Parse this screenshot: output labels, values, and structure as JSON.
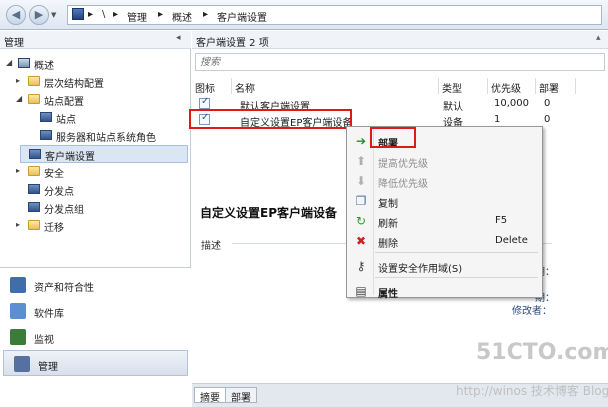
{
  "nav": {
    "breadcrumb": [
      "\\",
      "管理",
      "概述",
      "客户端设置"
    ],
    "separator": "▸"
  },
  "left": {
    "header": "管理",
    "tree": [
      {
        "label": "概述",
        "level": 0,
        "arrow": "◢",
        "icon": "overview-icon"
      },
      {
        "label": "层次结构配置",
        "level": 1,
        "arrow": "▸",
        "icon": "folder-icon"
      },
      {
        "label": "站点配置",
        "level": 1,
        "arrow": "◢",
        "icon": "folder-icon"
      },
      {
        "label": "站点",
        "level": 2,
        "arrow": "",
        "icon": "site-icon"
      },
      {
        "label": "服务器和站点系统角色",
        "level": 2,
        "arrow": "",
        "icon": "server-icon"
      },
      {
        "label": "客户端设置",
        "level": 1,
        "arrow": "",
        "icon": "client-settings-icon",
        "selected": true
      },
      {
        "label": "安全",
        "level": 1,
        "arrow": "▸",
        "icon": "folder-icon"
      },
      {
        "label": "分发点",
        "level": 1,
        "arrow": "",
        "icon": "distribution-point-icon"
      },
      {
        "label": "分发点组",
        "level": 1,
        "arrow": "",
        "icon": "distribution-group-icon"
      },
      {
        "label": "迁移",
        "level": 1,
        "arrow": "▸",
        "icon": "folder-icon"
      }
    ],
    "workspaces": [
      {
        "label": "资产和符合性",
        "icon": "assets-icon",
        "color": "#3f6ea8"
      },
      {
        "label": "软件库",
        "icon": "software-library-icon",
        "color": "#5b8fd1"
      },
      {
        "label": "监视",
        "icon": "monitoring-icon",
        "color": "#3a7d3a"
      },
      {
        "label": "管理",
        "icon": "administration-icon",
        "color": "#5670a0",
        "active": true
      }
    ]
  },
  "main": {
    "header": "客户端设置 2 项",
    "search_placeholder": "搜索",
    "columns": [
      "图标",
      "名称",
      "类型",
      "优先级",
      "部署"
    ],
    "rows": [
      {
        "name": "默认客户端设置",
        "type": "默认",
        "priority": "10,000",
        "deploy": "0"
      },
      {
        "name": "自定义设置EP客户端设备",
        "type": "设备",
        "priority": "1",
        "deploy": "0"
      }
    ],
    "detail_title": "自定义设置EP客户端设备",
    "detail_desc_label": "描述",
    "faded": [
      "期：",
      "期：",
      "修改者："
    ],
    "tabs": [
      "摘要",
      "部署"
    ]
  },
  "context_menu": [
    {
      "label": "部署",
      "icon": "deploy-icon",
      "glyph": "➔",
      "color": "#2c8a2c",
      "disabled": false,
      "key": ""
    },
    {
      "label": "提高优先级",
      "icon": "increase-priority-icon",
      "glyph": "⬆",
      "color": "#b0b0b0",
      "disabled": true,
      "key": ""
    },
    {
      "label": "降低优先级",
      "icon": "decrease-priority-icon",
      "glyph": "⬇",
      "color": "#b0b0b0",
      "disabled": true,
      "key": ""
    },
    {
      "label": "复制",
      "icon": "copy-icon",
      "glyph": "❐",
      "color": "#4a6ea8",
      "disabled": false,
      "key": ""
    },
    {
      "label": "刷新",
      "icon": "refresh-icon",
      "glyph": "↻",
      "color": "#2c9a2c",
      "disabled": false,
      "key": "F5"
    },
    {
      "label": "删除",
      "icon": "delete-icon",
      "glyph": "✖",
      "color": "#d02020",
      "disabled": false,
      "key": "Delete"
    },
    {
      "label": "设置安全作用域(S)",
      "icon": "security-scope-icon",
      "glyph": "⚷",
      "color": "#444444",
      "disabled": false,
      "key": ""
    },
    {
      "label": "属性",
      "icon": "properties-icon",
      "glyph": "▤",
      "color": "#444444",
      "disabled": false,
      "key": ""
    }
  ],
  "watermark": {
    "logo": "51CTO.com",
    "line": "http://winos 技术博客 Blog"
  },
  "colors": {
    "highlight": "#e01818",
    "selection": "#dbe6f4"
  }
}
